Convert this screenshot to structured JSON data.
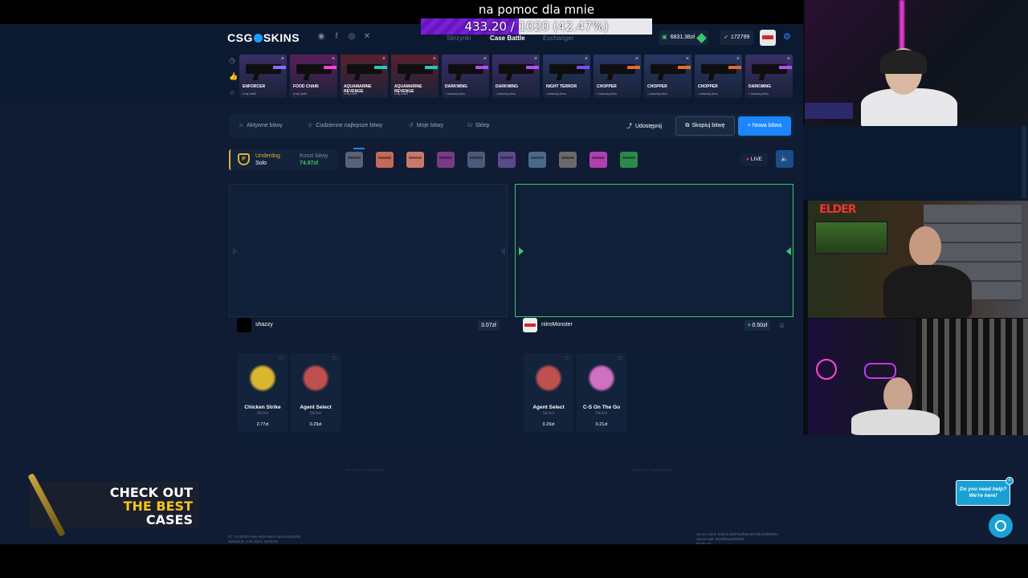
{
  "overlay": {
    "donation_title": "na pomoc dla mnie",
    "donation_text": "433.20 / 1020 (42.47%)",
    "donation_progress": 0.4247
  },
  "header": {
    "logo_left": "CSG",
    "logo_right": "SKINS",
    "nav": [
      "Skrzynki",
      "Case Battle",
      "Exchanger"
    ],
    "active_nav": "Case Battle",
    "balance": "6831.38zł",
    "coins": "172799",
    "accent": "#1c86ff"
  },
  "live_drops": [
    {
      "name": "ENFORCER",
      "sub": "w tej chwili",
      "bg": "#3a2f66",
      "accent": "#8a6cff"
    },
    {
      "name": "FOOD CHAIN",
      "sub": "w tej chwili",
      "bg": "#5a1f5c",
      "accent": "#ff3ddc"
    },
    {
      "name": "AQUAMARINE\nREVENGE",
      "sub": "w tej chwili",
      "bg": "#5a2030",
      "accent": "#2ac6b8"
    },
    {
      "name": "AQUAMARINE\nREVENGE",
      "sub": "w tej chwili",
      "bg": "#5a2030",
      "accent": "#2ac6b8"
    },
    {
      "name": "DARKWING",
      "sub": "1 sekundę temu",
      "bg": "#3a2f66",
      "accent": "#b64cff"
    },
    {
      "name": "DARKWING",
      "sub": "1 sekundę temu",
      "bg": "#3a2f66",
      "accent": "#b64cff"
    },
    {
      "name": "NIGHT TERROR",
      "sub": "1 sekundę temu",
      "bg": "#263763",
      "accent": "#7a4cff"
    },
    {
      "name": "CHOPPER",
      "sub": "1 sekundę temu",
      "bg": "#263763",
      "accent": "#e86a2a"
    },
    {
      "name": "CHOPPER",
      "sub": "1 sekundę temu",
      "bg": "#263763",
      "accent": "#e86a2a"
    },
    {
      "name": "CHOPPER",
      "sub": "1 sekundę temu",
      "bg": "#263763",
      "accent": "#e86a2a"
    },
    {
      "name": "DARKWING",
      "sub": "1 sekundę temu",
      "bg": "#3a2f66",
      "accent": "#b64cff"
    }
  ],
  "battle_tabs": {
    "active_battles": "Aktywne bitwy",
    "daily_best": "Codzienne najlepsze bitwy",
    "my_battles": "Moje bitwy",
    "shop": "Sklep",
    "share": "Udostępnij",
    "copy": "Skopiuj bitwę",
    "new_battle": "+ Nowa bitwa"
  },
  "mode": {
    "mode_line1": "Underdog",
    "mode_line2": "Solo",
    "cost_label": "Koszt bitwy",
    "cost_value": "74.97zł",
    "live": "LIVE"
  },
  "cases": [
    {
      "color": "#5a6275"
    },
    {
      "color": "#c46a5a"
    },
    {
      "color": "#c87a6a"
    },
    {
      "color": "#7a3a8a"
    },
    {
      "color": "#4a5a7a"
    },
    {
      "color": "#5a4a8a"
    },
    {
      "color": "#4a6a8a"
    },
    {
      "color": "#6a6a6a"
    },
    {
      "color": "#b040b0"
    },
    {
      "color": "#2a8a4a"
    }
  ],
  "players": [
    {
      "name": "shazzy",
      "total": "3.07zł",
      "seed": "Client seed: b73ffa2bf8e",
      "items": [
        {
          "name": "Chicken Strike",
          "type": "Sticker",
          "price": "2.77zł",
          "color": "#d9b530"
        },
        {
          "name": "Agent Select",
          "type": "Sticker",
          "price": "0.29zł",
          "color": "#c05050"
        }
      ]
    },
    {
      "name": "nitroMonster",
      "total": "0.50zł",
      "seed": "Client seed: 0aab3fbff75b",
      "items": [
        {
          "name": "Agent Select",
          "type": "Sticker",
          "price": "0.29zł",
          "color": "#c05050"
        },
        {
          "name": "C-S On The Go",
          "type": "Sticker",
          "price": "0.21zł",
          "color": "#d070c0"
        }
      ]
    }
  ],
  "footer": {
    "left1": "ID: 7478f220-f46e-4402-95ce-352ec080e885",
    "left2": "Started at: 4.05.2024, 20:09:00",
    "right1": "Server seed: 0a60fe4b8f7fa2f50e6f279b2b5f9b9be",
    "right2": "Secret salt: 60e5f6eae0fZ5f6f",
    "right3": "Public 0a"
  },
  "promo": {
    "line1": "CHECK OUT",
    "line2": "THE BEST",
    "line3": "CASES"
  },
  "help": {
    "bubble": "Do you need help?\nWe're here!"
  }
}
